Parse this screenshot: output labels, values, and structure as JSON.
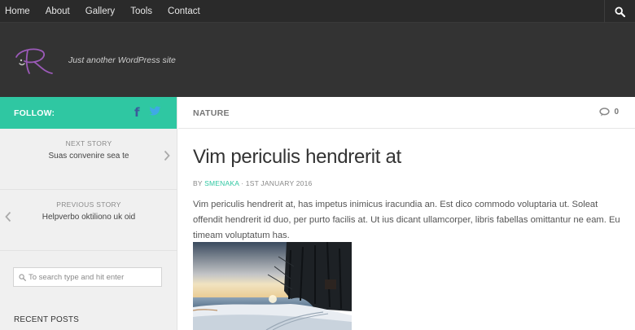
{
  "nav": {
    "items": [
      {
        "label": "Home"
      },
      {
        "label": "About"
      },
      {
        "label": "Gallery"
      },
      {
        "label": "Tools"
      },
      {
        "label": "Contact"
      }
    ],
    "search_icon": "search-icon"
  },
  "header": {
    "logo_icon": "site-logo",
    "tagline": "Just another WordPress site"
  },
  "sidebar": {
    "follow_label": "FOLLOW:",
    "social_icons": [
      "facebook-icon",
      "twitter-icon"
    ],
    "next_story": {
      "kicker": "NEXT STORY",
      "title": "Suas convenire sea te"
    },
    "previous_story": {
      "kicker": "PREVIOUS STORY",
      "title": "Helpverbo oktiliono uk oid"
    },
    "search_placeholder": "To search type and hit enter",
    "recent_posts_heading": "RECENT POSTS"
  },
  "post": {
    "category": "NATURE",
    "comment_count": "0",
    "title": "Vim periculis hendrerit at",
    "byline_prefix": "BY",
    "author": "SMENAKA",
    "date": "· 1ST JANUARY 2016",
    "excerpt": "Vim periculis hendrerit at, has impetus inimicus iracundia an. Est dico commodo voluptaria ut. Soleat offendit hendrerit id duo, per purto facilis at. Ut ius dicant ullamcorper, libris fabellas omittantur ne eam. Eu timeam voluptatum has."
  },
  "colors": {
    "accent": "#2fc7a2",
    "topbar": "#2a2a2a",
    "header": "#333333",
    "facebook": "#3b5b9a",
    "twitter": "#3fa9e6"
  }
}
